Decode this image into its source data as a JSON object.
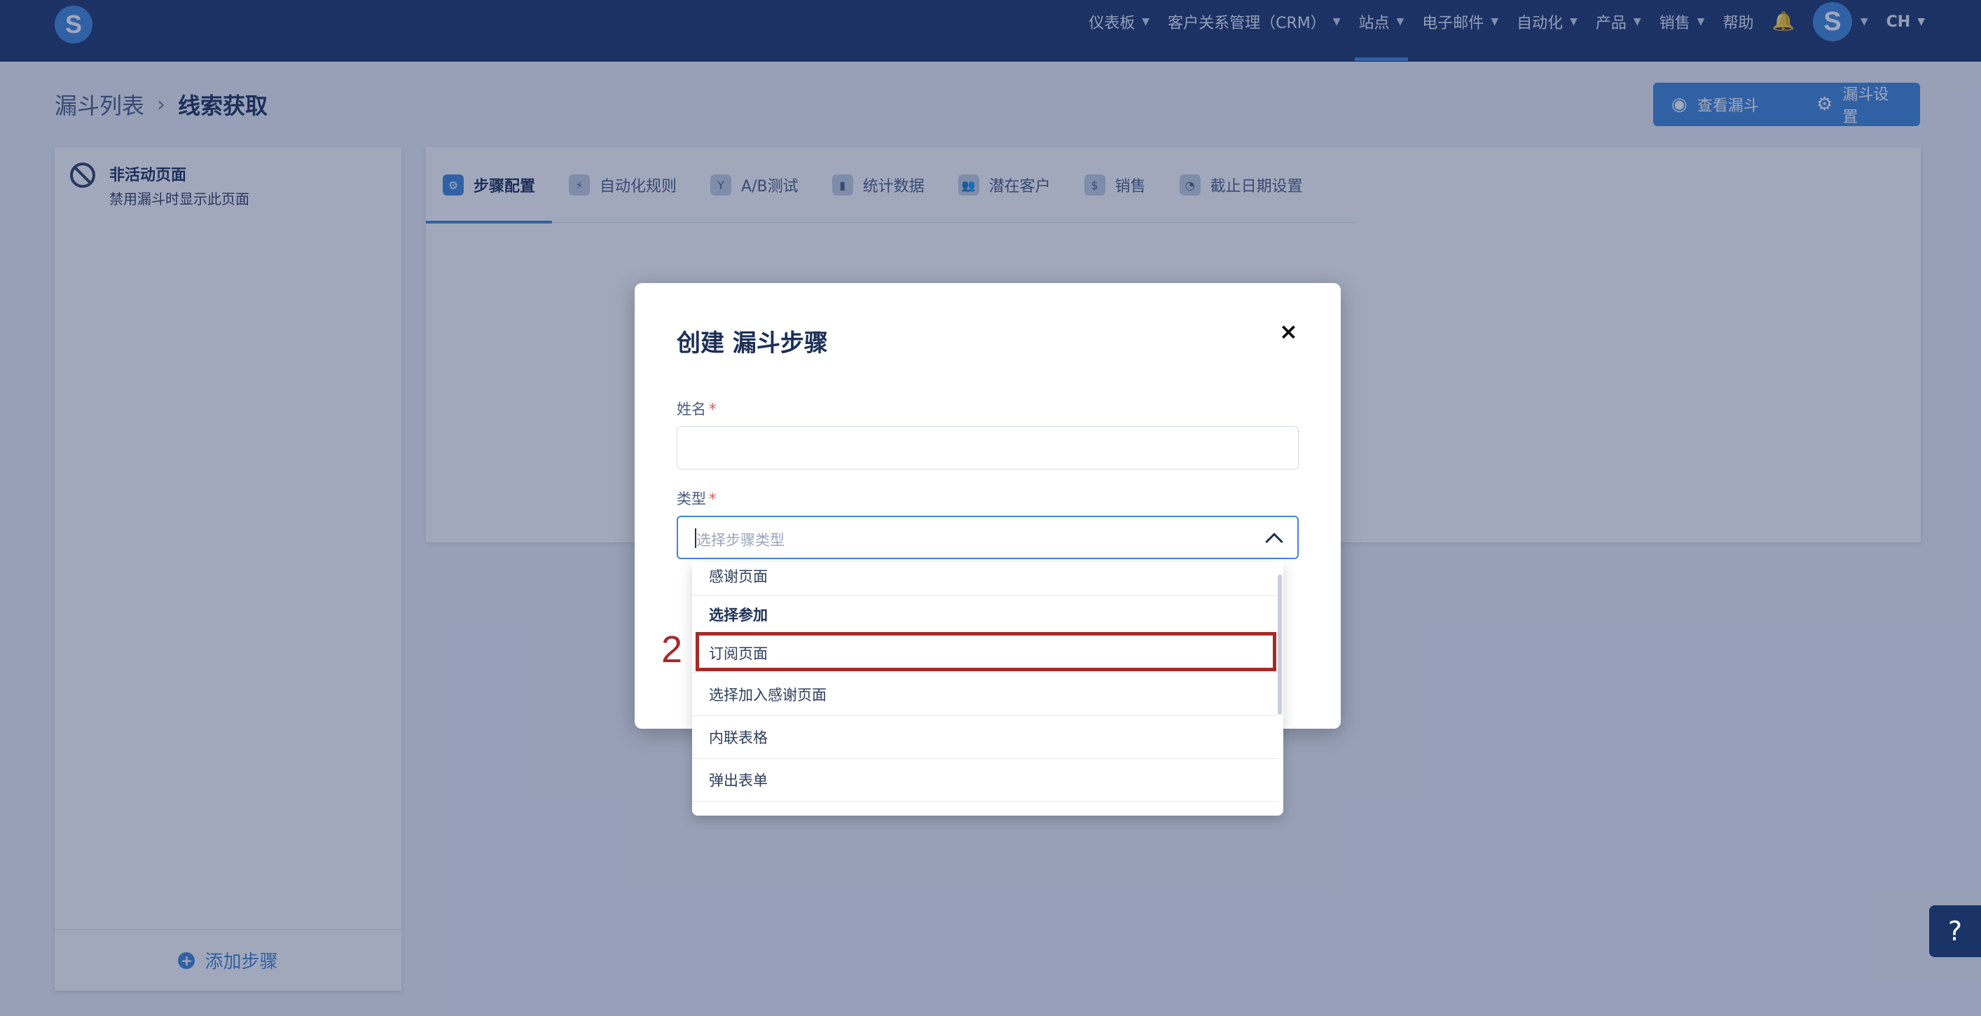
{
  "topbar": {
    "logo_letter": "S",
    "nav": [
      {
        "label": "仪表板",
        "has_dropdown": true
      },
      {
        "label": "客户关系管理（CRM）",
        "has_dropdown": true
      },
      {
        "label": "站点",
        "has_dropdown": true,
        "active": true
      },
      {
        "label": "电子邮件",
        "has_dropdown": true
      },
      {
        "label": "自动化",
        "has_dropdown": true
      },
      {
        "label": "产品",
        "has_dropdown": true
      },
      {
        "label": "销售",
        "has_dropdown": true
      },
      {
        "label": "帮助",
        "has_dropdown": false
      }
    ],
    "avatar_letter": "S",
    "language": "CH"
  },
  "header": {
    "breadcrumb_parent": "漏斗列表",
    "breadcrumb_current": "线索获取",
    "view_funnel_label": "查看漏斗",
    "funnel_settings_label": "漏斗设置"
  },
  "sidebar": {
    "inactive_title": "非活动页面",
    "inactive_subtitle": "禁用漏斗时显示此页面",
    "add_step_label": "添加步骤"
  },
  "tabs": [
    {
      "label": "步骤配置",
      "icon": "sliders-icon",
      "glyph": "⚙",
      "active": true
    },
    {
      "label": "自动化规则",
      "icon": "lightning-icon",
      "glyph": "⚡"
    },
    {
      "label": "A/B测试",
      "icon": "split-icon",
      "glyph": "Y"
    },
    {
      "label": "统计数据",
      "icon": "bar-chart-icon",
      "glyph": "▮"
    },
    {
      "label": "潜在客户",
      "icon": "users-icon",
      "glyph": "👥"
    },
    {
      "label": "销售",
      "icon": "dollar-icon",
      "glyph": "$"
    },
    {
      "label": "截止日期设置",
      "icon": "clock-icon",
      "glyph": "◔"
    }
  ],
  "modal": {
    "title": "创建 漏斗步骤",
    "close_glyph": "×",
    "name_label": "姓名",
    "name_value": "",
    "type_label": "类型",
    "required_mark": "*",
    "type_placeholder": "选择步骤类型"
  },
  "dropdown": {
    "items": [
      {
        "label": "感谢页面",
        "kind": "option"
      },
      {
        "label": "选择参加",
        "kind": "group"
      },
      {
        "label": "订阅页面",
        "kind": "option",
        "highlighted": true
      },
      {
        "label": "选择加入感谢页面",
        "kind": "option"
      },
      {
        "label": "内联表格",
        "kind": "option"
      },
      {
        "label": "弹出表单",
        "kind": "option"
      }
    ]
  },
  "annotation": {
    "step_number": "2",
    "color": "#a52a2a"
  },
  "help_glyph": "?",
  "colors": {
    "nav_bg": "#1a3468",
    "accent": "#3f86d8",
    "overlay": "rgba(30,48,96,0.42)"
  }
}
